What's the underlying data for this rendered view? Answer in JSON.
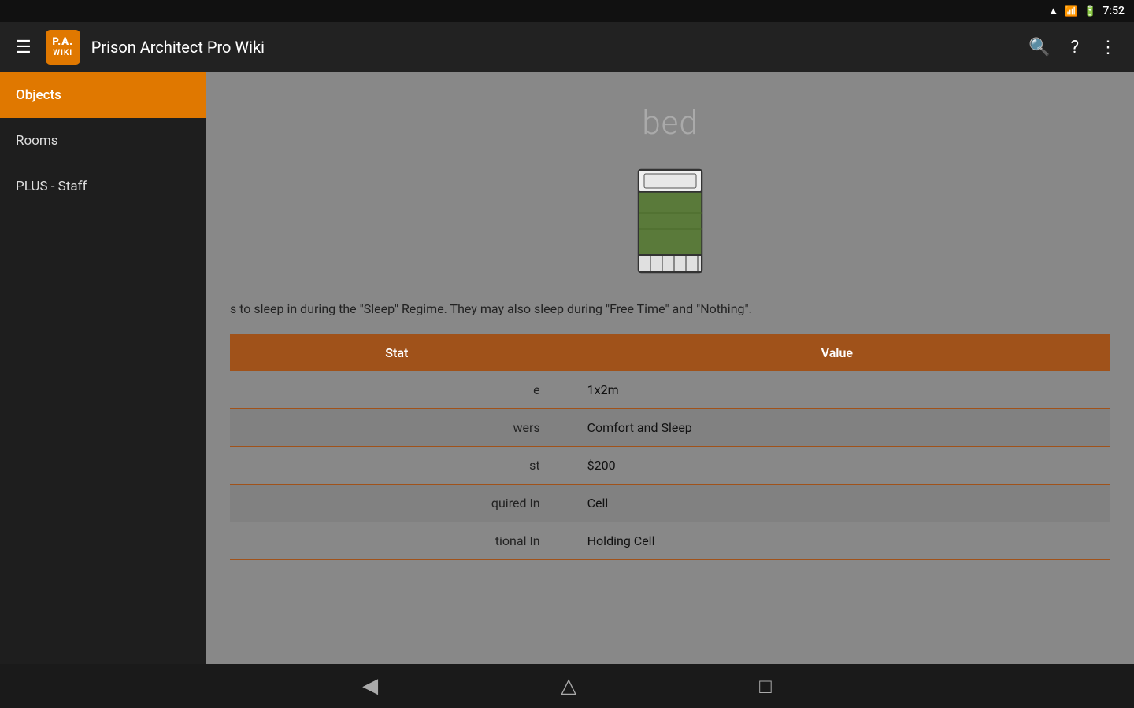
{
  "statusBar": {
    "time": "7:52",
    "wifiIcon": "wifi",
    "batteryIcon": "battery"
  },
  "appBar": {
    "logoLine1": "P.A.",
    "logoLine2": "WIKI",
    "title": "Prison Architect Pro Wiki",
    "searchLabel": "Search",
    "helpLabel": "Help",
    "moreLabel": "More options"
  },
  "sidebar": {
    "items": [
      {
        "label": "Objects",
        "active": true
      },
      {
        "label": "Rooms",
        "active": false
      },
      {
        "label": "PLUS - Staff",
        "active": false
      }
    ]
  },
  "content": {
    "pageTitle": "bed",
    "description": "s to sleep in during the \"Sleep\" Regime. They may also sleep during \"Free Time\" and \"Nothing\".",
    "table": {
      "headers": [
        "Stat",
        "Value"
      ],
      "rows": [
        {
          "stat": "e",
          "value": "1x2m"
        },
        {
          "stat": "wers",
          "value": "Comfort and Sleep"
        },
        {
          "stat": "st",
          "value": "$200"
        },
        {
          "stat": "quired In",
          "value": "Cell"
        },
        {
          "stat": "tional In",
          "value": "Holding Cell"
        }
      ]
    }
  },
  "bottomNav": {
    "backLabel": "Back",
    "homeLabel": "Home",
    "recentLabel": "Recent"
  }
}
